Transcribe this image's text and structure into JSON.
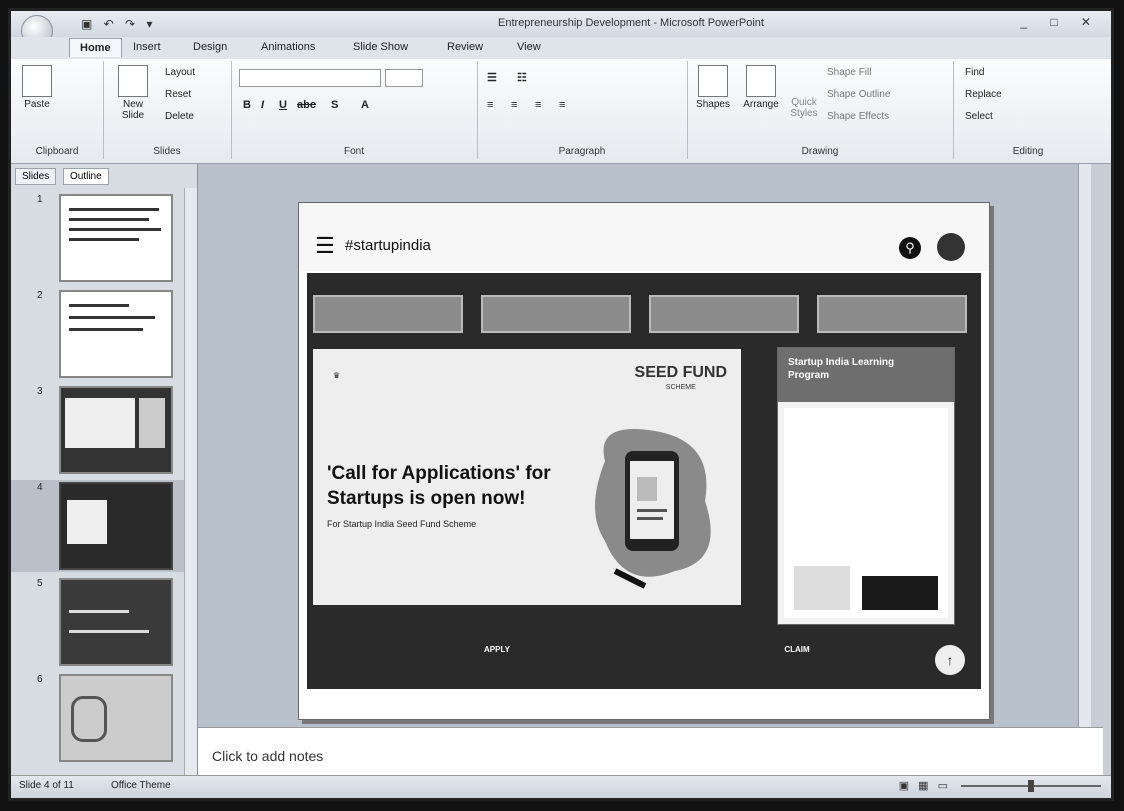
{
  "window": {
    "title": "Entrepreneurship Development - Microsoft PowerPoint"
  },
  "ribbon": {
    "tabs": [
      "Home",
      "Insert",
      "Design",
      "Animations",
      "Slide Show",
      "Review",
      "View"
    ],
    "clipboard": {
      "paste": "Paste",
      "label": "Clipboard"
    },
    "slides": {
      "new_slide": "New Slide",
      "layout": "Layout",
      "reset": "Reset",
      "delete": "Delete",
      "label": "Slides"
    },
    "font": {
      "label": "Font"
    },
    "paragraph": {
      "label": "Paragraph"
    },
    "drawing": {
      "shapes": "Shapes",
      "arrange": "Arrange",
      "quick_styles": "Quick Styles",
      "shape_fill": "Shape Fill",
      "shape_outline": "Shape Outline",
      "shape_effects": "Shape Effects",
      "label": "Drawing"
    },
    "editing": {
      "find": "Find",
      "replace": "Replace",
      "select": "Select",
      "label": "Editing"
    }
  },
  "panel": {
    "tabs": [
      "Slides",
      "Outline"
    ],
    "thumbnail_numbers": [
      "1",
      "2",
      "3",
      "4",
      "5",
      "6"
    ]
  },
  "slide": {
    "logo": "#startupindia",
    "buttons": [
      "",
      "",
      "",
      ""
    ],
    "seed_logo": "SEED FUND",
    "seed_sub": "SCHEME",
    "headline": "'Call for Applications' for Startups is open now!",
    "subline": "For Startup India Seed Fund Scheme",
    "card_title": "Startup India Learning Program",
    "card_text": "",
    "bottom_left": "APPLY",
    "bottom_right": "CLAIM",
    "fab": "↑"
  },
  "notes": {
    "placeholder": "Click to add notes"
  },
  "status": {
    "slide_count": "Slide 4 of 11",
    "theme": "Office Theme",
    "zoom_level": 0.5
  }
}
